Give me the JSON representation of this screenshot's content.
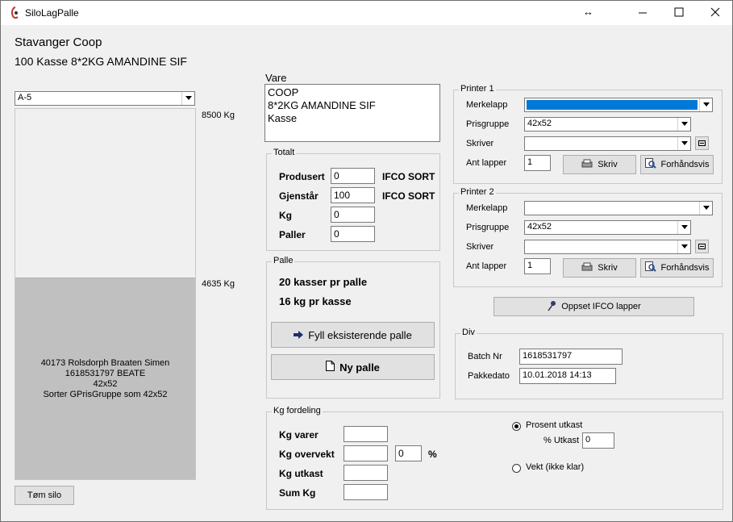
{
  "window": {
    "title": "SiloLagPalle",
    "accent": "#0078d7"
  },
  "header": {
    "customer": "Stavanger Coop",
    "item": "100 Kasse 8*2KG AMANDINE SIF"
  },
  "silo": {
    "selected": "A-5",
    "capacity_label": "8500 Kg",
    "level_label": "4635 Kg",
    "fill_fraction": 0.545,
    "info_line1": "40173 Rolsdorph Braaten Simen",
    "info_line2": "1618531797 BEATE",
    "info_line3": "42x52",
    "info_line4": "Sorter GPrisGruppe som 42x52",
    "empty_button": "Tøm silo"
  },
  "vare": {
    "label": "Vare",
    "line1": "COOP",
    "line2": "8*2KG AMANDINE SIF",
    "line3": "Kasse"
  },
  "totalt": {
    "legend": "Totalt",
    "produsert_label": "Produsert",
    "produsert_value": "0",
    "produsert_unit": "IFCO SORT",
    "gjenstar_label": "Gjenstår",
    "gjenstar_value": "100",
    "gjenstar_unit": "IFCO SORT",
    "kg_label": "Kg",
    "kg_value": "0",
    "paller_label": "Paller",
    "paller_value": "0"
  },
  "palle": {
    "legend": "Palle",
    "per_palle": "20 kasser pr palle",
    "per_kasse": "16 kg pr kasse",
    "fill_button": "Fyll eksisterende palle",
    "new_button": "Ny palle"
  },
  "printer1": {
    "legend": "Printer 1",
    "merkelapp_label": "Merkelapp",
    "merkelapp_value": "",
    "prisgruppe_label": "Prisgruppe",
    "prisgruppe_value": "42x52",
    "skriver_label": "Skriver",
    "skriver_value": "",
    "antlapper_label": "Ant lapper",
    "antlapper_value": "1",
    "skriv_button": "Skriv",
    "preview_button": "Forhåndsvis"
  },
  "printer2": {
    "legend": "Printer 2",
    "merkelapp_label": "Merkelapp",
    "merkelapp_value": "",
    "prisgruppe_label": "Prisgruppe",
    "prisgruppe_value": "42x52",
    "skriver_label": "Skriver",
    "skriver_value": "",
    "antlapper_label": "Ant lapper",
    "antlapper_value": "1",
    "skriv_button": "Skriv",
    "preview_button": "Forhåndsvis"
  },
  "ifco_button": "Oppset IFCO lapper",
  "div": {
    "legend": "Div",
    "batch_label": "Batch Nr",
    "batch_value": "1618531797",
    "pakkedato_label": "Pakkedato",
    "pakkedato_value": "10.01.2018 14:13"
  },
  "kg_fordeling": {
    "legend": "Kg fordeling",
    "kg_varer_label": "Kg varer",
    "kg_varer_value": "",
    "kg_overvekt_label": "Kg overvekt",
    "kg_overvekt_value": "",
    "overvekt_pct_value": "0",
    "pct_sign": "%",
    "kg_utkast_label": "Kg utkast",
    "kg_utkast_value": "",
    "sum_kg_label": "Sum Kg",
    "sum_kg_value": "",
    "prosent_label": "Prosent utkast",
    "utkast_pct_label": "% Utkast",
    "utkast_pct_value": "0",
    "vekt_label": "Vekt (ikke klar)"
  }
}
